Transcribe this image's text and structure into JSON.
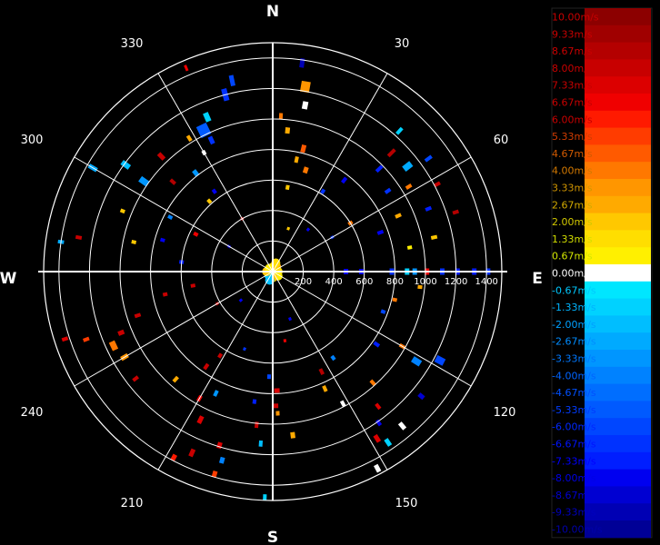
{
  "chart_data": {
    "type": "polar-radial-velocity-map",
    "title": "",
    "cardinals": [
      "N",
      "E",
      "S",
      "W"
    ],
    "azimuth_labels": [
      "30",
      "60",
      "120",
      "150",
      "210",
      "240",
      "300",
      "330"
    ],
    "range_labels": [
      "200",
      "400",
      "600",
      "800",
      "1000",
      "1200",
      "1400"
    ],
    "range_unit": "",
    "rmax": 1500,
    "ring_ranges": [
      200,
      400,
      600,
      800,
      1000,
      1200,
      1400
    ],
    "spoke_azimuths": [
      0,
      30,
      60,
      90,
      120,
      150,
      180,
      210,
      240,
      270,
      300,
      330
    ],
    "legend": {
      "labels": [
        "10.00m/s",
        "9.33m/s",
        "8.67m/s",
        "8.00m/s",
        "7.33m/s",
        "6.67m/s",
        "6.00m/s",
        "5.33m/s",
        "4.67m/s",
        "4.00m/s",
        "3.33m/s",
        "2.67m/s",
        "2.00m/s",
        "1.33m/s",
        "0.67m/s",
        "0.00m/s",
        "-0.67m/s",
        "-1.33m/s",
        "-2.00m/s",
        "-2.67m/s",
        "-3.33m/s",
        "-4.00m/s",
        "-4.67m/s",
        "-5.33m/s",
        "-6.00m/s",
        "-6.67m/s",
        "-7.33m/s",
        "-8.00m/s",
        "-8.67m/s",
        "-9.33m/s",
        "-10.00m/s"
      ],
      "colors": [
        "#8c0000",
        "#a00000",
        "#b40000",
        "#c80000",
        "#dc0000",
        "#f00000",
        "#ff1a00",
        "#ff3c00",
        "#ff5a00",
        "#ff7800",
        "#ff9600",
        "#ffaa00",
        "#ffc800",
        "#ffde00",
        "#fff000",
        "#ffffff",
        "#00e6ff",
        "#00d2ff",
        "#00beff",
        "#00aaff",
        "#0096ff",
        "#0082ff",
        "#006eff",
        "#005aff",
        "#0046ff",
        "#0032ff",
        "#001eff",
        "#0000f0",
        "#0000d2",
        "#0000b4",
        "#000096"
      ],
      "label_colors": [
        "#c80000",
        "#c80000",
        "#c80000",
        "#c80000",
        "#c80000",
        "#c80000",
        "#c80000",
        "#d23c00",
        "#d25a00",
        "#d27800",
        "#d29600",
        "#d2aa00",
        "#d2c800",
        "#d2de00",
        "#d2e600",
        "#ffffff",
        "#00c8ff",
        "#00b4ff",
        "#00a0ff",
        "#008cff",
        "#0078ff",
        "#0064ff",
        "#0050ff",
        "#003cff",
        "#0028ff",
        "#0014ff",
        "#0000ff",
        "#0000e6",
        "#0000d2",
        "#0000be",
        "#0000aa"
      ]
    },
    "points": [
      {
        "az": 8,
        "r": 1380,
        "v": -9.3,
        "len": 60,
        "wd": 5
      },
      {
        "az": 10,
        "r": 1230,
        "v": 3.3,
        "len": 70,
        "wd": 10
      },
      {
        "az": 11,
        "r": 1110,
        "v": 0.0,
        "len": 50,
        "wd": 6
      },
      {
        "az": 3,
        "r": 1020,
        "v": 4.0,
        "len": 40,
        "wd": 4
      },
      {
        "az": 6,
        "r": 930,
        "v": 2.7,
        "len": 40,
        "wd": 5
      },
      {
        "az": 14,
        "r": 830,
        "v": 4.7,
        "len": 50,
        "wd": 5
      },
      {
        "az": 12,
        "r": 750,
        "v": 2.7,
        "len": 40,
        "wd": 4
      },
      {
        "az": 18,
        "r": 700,
        "v": 4.0,
        "len": 40,
        "wd": 5
      },
      {
        "az": 10,
        "r": 560,
        "v": 2.0,
        "len": 30,
        "wd": 4
      },
      {
        "az": 348,
        "r": 1280,
        "v": -6.0,
        "len": 70,
        "wd": 5
      },
      {
        "az": 345,
        "r": 1200,
        "v": -6.7,
        "len": 80,
        "wd": 6
      },
      {
        "az": 337,
        "r": 1100,
        "v": -1.3,
        "len": 60,
        "wd": 6
      },
      {
        "az": 334,
        "r": 1030,
        "v": -5.3,
        "len": 80,
        "wd": 12
      },
      {
        "az": 335,
        "r": 950,
        "v": -6.7,
        "len": 50,
        "wd": 5
      },
      {
        "az": 330,
        "r": 900,
        "v": 0.0,
        "len": 30,
        "wd": 4
      },
      {
        "az": 328,
        "r": 1030,
        "v": 2.7,
        "len": 40,
        "wd": 4
      },
      {
        "az": 322,
        "r": 820,
        "v": -3.3,
        "len": 40,
        "wd": 5
      },
      {
        "az": 316,
        "r": 1050,
        "v": 8.0,
        "len": 50,
        "wd": 5
      },
      {
        "az": 306,
        "r": 1190,
        "v": -2.0,
        "len": 60,
        "wd": 6
      },
      {
        "az": 305,
        "r": 1030,
        "v": -3.3,
        "len": 60,
        "wd": 7
      },
      {
        "az": 312,
        "r": 880,
        "v": 8.7,
        "len": 40,
        "wd": 4
      },
      {
        "az": 300,
        "r": 1360,
        "v": -2.7,
        "len": 60,
        "wd": 5
      },
      {
        "az": 298,
        "r": 760,
        "v": -4.0,
        "len": 30,
        "wd": 4
      },
      {
        "az": 318,
        "r": 620,
        "v": 2.0,
        "len": 30,
        "wd": 4
      },
      {
        "az": 324,
        "r": 650,
        "v": -8.0,
        "len": 30,
        "wd": 4
      },
      {
        "az": 337,
        "r": 1450,
        "v": 6.7,
        "len": 40,
        "wd": 3
      },
      {
        "az": 42,
        "r": 1240,
        "v": -1.3,
        "len": 50,
        "wd": 4
      },
      {
        "az": 45,
        "r": 1100,
        "v": 8.7,
        "len": 60,
        "wd": 4
      },
      {
        "az": 54,
        "r": 1260,
        "v": -6.0,
        "len": 50,
        "wd": 4
      },
      {
        "az": 52,
        "r": 1120,
        "v": -2.7,
        "len": 60,
        "wd": 7
      },
      {
        "az": 46,
        "r": 970,
        "v": -7.3,
        "len": 50,
        "wd": 4
      },
      {
        "az": 55,
        "r": 920,
        "v": -6.7,
        "len": 40,
        "wd": 4
      },
      {
        "az": 58,
        "r": 1050,
        "v": 4.0,
        "len": 40,
        "wd": 4
      },
      {
        "az": 62,
        "r": 1220,
        "v": 8.0,
        "len": 40,
        "wd": 4
      },
      {
        "az": 68,
        "r": 1100,
        "v": -7.3,
        "len": 40,
        "wd": 4
      },
      {
        "az": 72,
        "r": 1260,
        "v": 8.7,
        "len": 40,
        "wd": 4
      },
      {
        "az": 66,
        "r": 900,
        "v": 2.7,
        "len": 40,
        "wd": 4
      },
      {
        "az": 70,
        "r": 750,
        "v": -8.0,
        "len": 40,
        "wd": 4
      },
      {
        "az": 38,
        "r": 760,
        "v": -8.0,
        "len": 40,
        "wd": 4
      },
      {
        "az": 32,
        "r": 620,
        "v": -6.7,
        "len": 30,
        "wd": 4
      },
      {
        "az": 78,
        "r": 1080,
        "v": 2.0,
        "len": 40,
        "wd": 4
      },
      {
        "az": 80,
        "r": 910,
        "v": 0.7,
        "len": 30,
        "wd": 4
      },
      {
        "az": 58,
        "r": 600,
        "v": 4.0,
        "len": 30,
        "wd": 4
      },
      {
        "az": 90,
        "r": 1210,
        "v": -7.3,
        "len": 30,
        "wd": 7
      },
      {
        "az": 90,
        "r": 1110,
        "v": -6.7,
        "len": 30,
        "wd": 7
      },
      {
        "az": 90,
        "r": 1010,
        "v": 6.7,
        "len": 30,
        "wd": 7
      },
      {
        "az": 90,
        "r": 930,
        "v": -3.3,
        "len": 30,
        "wd": 7
      },
      {
        "az": 90,
        "r": 880,
        "v": -1.3,
        "len": 30,
        "wd": 7
      },
      {
        "az": 90,
        "r": 780,
        "v": -6.7,
        "len": 30,
        "wd": 7
      },
      {
        "az": 90,
        "r": 580,
        "v": -8.0,
        "len": 30,
        "wd": 6
      },
      {
        "az": 90,
        "r": 480,
        "v": -8.0,
        "len": 30,
        "wd": 6
      },
      {
        "az": 90,
        "r": 1410,
        "v": -6.7,
        "len": 30,
        "wd": 7
      },
      {
        "az": 90,
        "r": 1320,
        "v": -7.3,
        "len": 30,
        "wd": 7
      },
      {
        "az": 96,
        "r": 970,
        "v": 2.7,
        "len": 30,
        "wd": 4
      },
      {
        "az": 103,
        "r": 820,
        "v": 4.0,
        "len": 30,
        "wd": 4
      },
      {
        "az": 110,
        "r": 770,
        "v": -6.0,
        "len": 30,
        "wd": 4
      },
      {
        "az": 118,
        "r": 1240,
        "v": -6.0,
        "len": 60,
        "wd": 8
      },
      {
        "az": 122,
        "r": 1110,
        "v": -4.0,
        "len": 60,
        "wd": 7
      },
      {
        "az": 120,
        "r": 980,
        "v": 4.0,
        "len": 40,
        "wd": 4
      },
      {
        "az": 125,
        "r": 830,
        "v": -7.3,
        "len": 40,
        "wd": 4
      },
      {
        "az": 130,
        "r": 1270,
        "v": -8.7,
        "len": 40,
        "wd": 5
      },
      {
        "az": 140,
        "r": 1320,
        "v": 0.0,
        "len": 50,
        "wd": 5
      },
      {
        "az": 146,
        "r": 1350,
        "v": -1.3,
        "len": 50,
        "wd": 5
      },
      {
        "az": 148,
        "r": 1290,
        "v": 7.3,
        "len": 50,
        "wd": 5
      },
      {
        "az": 145,
        "r": 1210,
        "v": -8.0,
        "len": 40,
        "wd": 4
      },
      {
        "az": 152,
        "r": 1460,
        "v": 0.0,
        "len": 50,
        "wd": 5
      },
      {
        "az": 142,
        "r": 1120,
        "v": 7.3,
        "len": 40,
        "wd": 4
      },
      {
        "az": 152,
        "r": 980,
        "v": 0.0,
        "len": 40,
        "wd": 4
      },
      {
        "az": 156,
        "r": 840,
        "v": 2.7,
        "len": 40,
        "wd": 4
      },
      {
        "az": 154,
        "r": 730,
        "v": 8.7,
        "len": 40,
        "wd": 4
      },
      {
        "az": 145,
        "r": 690,
        "v": -4.0,
        "len": 30,
        "wd": 4
      },
      {
        "az": 138,
        "r": 980,
        "v": 4.0,
        "len": 40,
        "wd": 4
      },
      {
        "az": 173,
        "r": 1080,
        "v": 2.7,
        "len": 40,
        "wd": 5
      },
      {
        "az": 178,
        "r": 930,
        "v": 3.3,
        "len": 30,
        "wd": 4
      },
      {
        "az": 179,
        "r": 880,
        "v": 8.0,
        "len": 30,
        "wd": 7
      },
      {
        "az": 178,
        "r": 780,
        "v": 7.3,
        "len": 30,
        "wd": 6
      },
      {
        "az": 182,
        "r": 690,
        "v": -6.0,
        "len": 30,
        "wd": 4
      },
      {
        "az": 184,
        "r": 1130,
        "v": -2.0,
        "len": 40,
        "wd": 4
      },
      {
        "az": 186,
        "r": 1010,
        "v": 8.0,
        "len": 40,
        "wd": 4
      },
      {
        "az": 188,
        "r": 860,
        "v": -7.3,
        "len": 30,
        "wd": 4
      },
      {
        "az": 182,
        "r": 1480,
        "v": -1.3,
        "len": 40,
        "wd": 4
      },
      {
        "az": 196,
        "r": 1380,
        "v": 5.3,
        "len": 40,
        "wd": 5
      },
      {
        "az": 195,
        "r": 1280,
        "v": -4.0,
        "len": 40,
        "wd": 5
      },
      {
        "az": 197,
        "r": 1190,
        "v": 7.3,
        "len": 40,
        "wd": 5
      },
      {
        "az": 204,
        "r": 1300,
        "v": 8.0,
        "len": 50,
        "wd": 5
      },
      {
        "az": 208,
        "r": 1380,
        "v": 6.0,
        "len": 40,
        "wd": 5
      },
      {
        "az": 206,
        "r": 1080,
        "v": 7.3,
        "len": 50,
        "wd": 5
      },
      {
        "az": 210,
        "r": 960,
        "v": 6.7,
        "len": 40,
        "wd": 4
      },
      {
        "az": 205,
        "r": 880,
        "v": -3.3,
        "len": 40,
        "wd": 4
      },
      {
        "az": 215,
        "r": 760,
        "v": 8.0,
        "len": 40,
        "wd": 4
      },
      {
        "az": 212,
        "r": 650,
        "v": 8.0,
        "len": 30,
        "wd": 4
      },
      {
        "az": 222,
        "r": 950,
        "v": 2.7,
        "len": 40,
        "wd": 4
      },
      {
        "az": 232,
        "r": 1140,
        "v": 8.0,
        "len": 40,
        "wd": 4
      },
      {
        "az": 240,
        "r": 1120,
        "v": 3.3,
        "len": 50,
        "wd": 5
      },
      {
        "az": 245,
        "r": 1150,
        "v": 4.0,
        "len": 40,
        "wd": 10
      },
      {
        "az": 248,
        "r": 1070,
        "v": 8.0,
        "len": 40,
        "wd": 5
      },
      {
        "az": 250,
        "r": 1300,
        "v": 5.3,
        "len": 40,
        "wd": 4
      },
      {
        "az": 252,
        "r": 930,
        "v": 8.0,
        "len": 40,
        "wd": 4
      },
      {
        "az": 258,
        "r": 720,
        "v": 8.0,
        "len": 30,
        "wd": 4
      },
      {
        "az": 252,
        "r": 1430,
        "v": 7.3,
        "len": 40,
        "wd": 4
      },
      {
        "az": 260,
        "r": 530,
        "v": 8.0,
        "len": 30,
        "wd": 4
      },
      {
        "az": 280,
        "r": 1290,
        "v": 8.0,
        "len": 40,
        "wd": 4
      },
      {
        "az": 278,
        "r": 1400,
        "v": -2.7,
        "len": 40,
        "wd": 4
      },
      {
        "az": 282,
        "r": 930,
        "v": 2.0,
        "len": 30,
        "wd": 4
      },
      {
        "az": 286,
        "r": 750,
        "v": -8.0,
        "len": 30,
        "wd": 4
      },
      {
        "az": 276,
        "r": 600,
        "v": -7.3,
        "len": 30,
        "wd": 4
      },
      {
        "az": 292,
        "r": 1060,
        "v": 2.0,
        "len": 30,
        "wd": 4
      },
      {
        "az": 296,
        "r": 560,
        "v": 6.7,
        "len": 30,
        "wd": 4
      },
      {
        "az": 240,
        "r": 420,
        "v": 8.0,
        "len": 20,
        "wd": 3
      },
      {
        "az": 228,
        "r": 280,
        "v": -8.0,
        "len": 20,
        "wd": 3
      },
      {
        "az": 160,
        "r": 330,
        "v": -8.0,
        "len": 20,
        "wd": 3
      },
      {
        "az": 170,
        "r": 460,
        "v": 6.7,
        "len": 20,
        "wd": 3
      },
      {
        "az": 200,
        "r": 540,
        "v": -6.7,
        "len": 20,
        "wd": 3
      },
      {
        "az": 40,
        "r": 360,
        "v": -8.0,
        "len": 20,
        "wd": 3
      },
      {
        "az": 60,
        "r": 450,
        "v": -6.7,
        "len": 20,
        "wd": 3
      },
      {
        "az": 330,
        "r": 400,
        "v": 8.0,
        "len": 20,
        "wd": 3
      },
      {
        "az": 300,
        "r": 330,
        "v": -8.7,
        "len": 20,
        "wd": 3
      },
      {
        "az": 20,
        "r": 300,
        "v": 2.0,
        "len": 20,
        "wd": 3
      }
    ],
    "center_clutter": [
      {
        "az": 0,
        "r": 30,
        "v": 2.0
      },
      {
        "az": 40,
        "r": 40,
        "v": 2.7
      },
      {
        "az": 90,
        "r": 35,
        "v": 1.3
      },
      {
        "az": 130,
        "r": 45,
        "v": 0.7
      },
      {
        "az": 180,
        "r": 40,
        "v": 2.0
      },
      {
        "az": 225,
        "r": 35,
        "v": -1.3
      },
      {
        "az": 270,
        "r": 40,
        "v": 2.0
      },
      {
        "az": 315,
        "r": 30,
        "v": 0.7
      },
      {
        "az": 200,
        "r": 60,
        "v": -2.0
      },
      {
        "az": 20,
        "r": 60,
        "v": 1.3
      }
    ]
  }
}
